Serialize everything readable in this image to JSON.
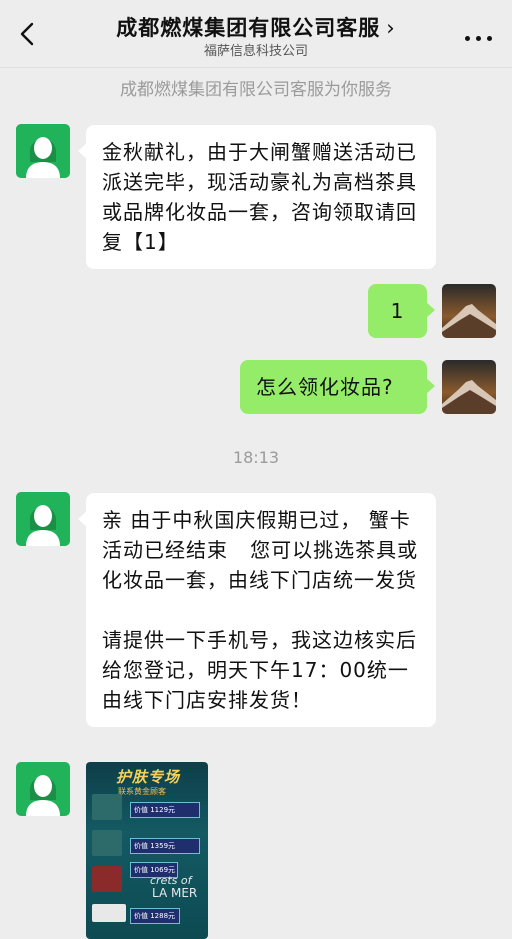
{
  "header": {
    "title": "成都燃煤集团有限公司客服",
    "title_chevron": "›",
    "subtitle": "福萨信息科技公司",
    "back_icon": "chevron-left-icon",
    "more_icon": "more-dots-icon"
  },
  "system_notice": "成都燃煤集团有限公司客服为你服务",
  "messages": [
    {
      "from": "service",
      "text": "金秋献礼，由于大闸蟹赠送活动已派送完毕，现活动豪礼为高档茶具或品牌化妆品一套，咨询领取请回复【1】"
    },
    {
      "from": "me",
      "text": "1"
    },
    {
      "from": "me",
      "text": "怎么领化妆品?"
    },
    {
      "from": "service",
      "text": "亲 由于中秋国庆假期已过， 蟹卡活动已经结束   您可以挑选茶具或化妆品一套，由线下门店统一发货\n\n请提供一下手机号，我这边核实后给您登记，明天下午17：00统一由线下门店安排发货！"
    }
  ],
  "timestamp": "18:13",
  "image_message": {
    "headline": "护肤专场",
    "subhead": "联系黄金顾客",
    "prices": [
      "价值 1129元",
      "价值 1359元",
      "价值 1069元",
      "价值 1288元"
    ],
    "brand_line1": "crets of",
    "brand_line2": "LA MER"
  },
  "colors": {
    "me_bubble": "#95ec69",
    "service_bubble": "#ffffff",
    "background": "#ededed",
    "avatar_green": "#20b35a"
  }
}
